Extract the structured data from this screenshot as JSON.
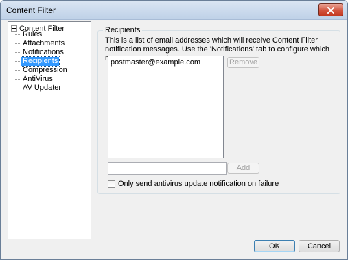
{
  "window": {
    "title": "Content Filter"
  },
  "title_bar": {
    "close_icon": "close-x-icon"
  },
  "tree": {
    "root_label": "Content Filter",
    "items": [
      {
        "label": "Rules"
      },
      {
        "label": "Attachments"
      },
      {
        "label": "Notifications"
      },
      {
        "label": "Recipients",
        "selected": true
      },
      {
        "label": "Compression"
      },
      {
        "label": "AntiVirus"
      },
      {
        "label": "AV Updater"
      }
    ]
  },
  "recipients": {
    "group_title": "Recipients",
    "description": "This is a list of email addresses which will receive Content Filter notification messages.  Use the 'Notifications' tab to configure which messages are sent.",
    "list_items": [
      "postmaster@example.com"
    ],
    "remove_label": "Remove",
    "add_input_value": "",
    "add_label": "Add",
    "checkbox_label": "Only send antivirus update notification on failure",
    "checkbox_checked": false
  },
  "footer": {
    "ok_label": "OK",
    "cancel_label": "Cancel"
  }
}
